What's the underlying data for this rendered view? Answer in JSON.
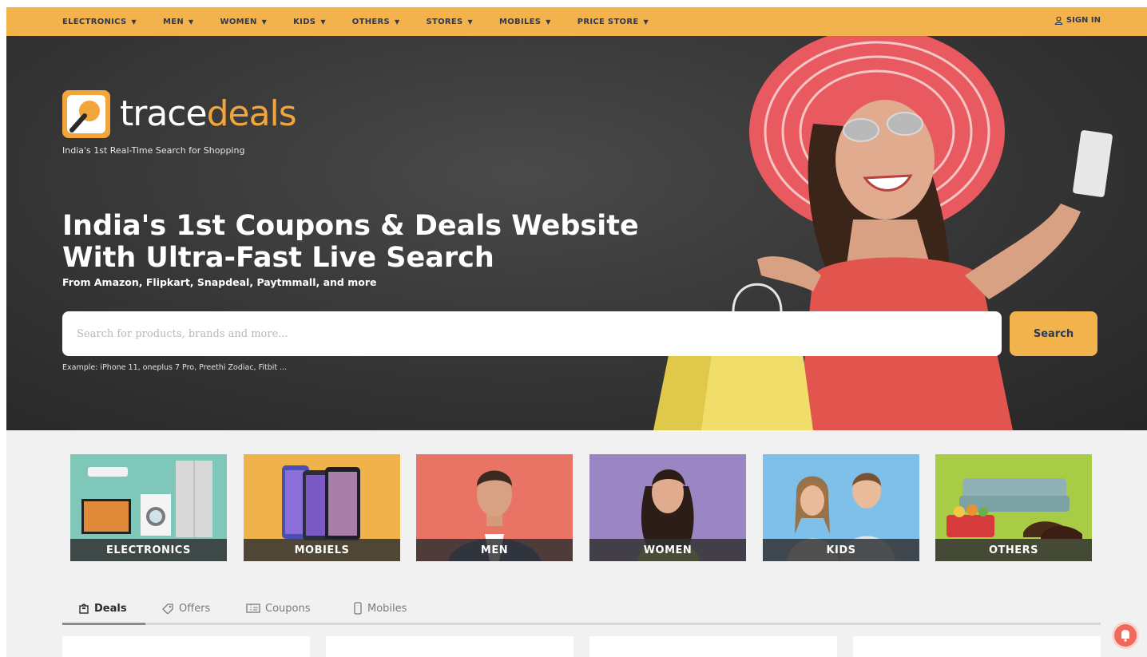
{
  "nav": {
    "items": [
      "ELECTRONICS",
      "MEN",
      "WOMEN",
      "KIDS",
      "OTHERS",
      "STORES",
      "MOBILES",
      "PRICE STORE"
    ],
    "signin": "SIGN IN"
  },
  "hero": {
    "logo_trace": "trace",
    "logo_deals": "deals",
    "tagline": "India's 1st Real-Time Search for Shopping",
    "headline": "India's 1st Coupons & Deals Website With Ultra-Fast Live Search",
    "subhead": "From Amazon, Flipkart, Snapdeal, Paytmmall, and more",
    "search_placeholder": "Search for products, brands and more...",
    "search_button": "Search",
    "example": "Example: iPhone 11, oneplus 7 Pro, Preethi Zodiac, Fitbit ..."
  },
  "categories": [
    {
      "label": "ELECTRONICS",
      "bg": "#7fc7b8"
    },
    {
      "label": "MOBIELS",
      "bg": "#f0b24a"
    },
    {
      "label": "MEN",
      "bg": "#e97466"
    },
    {
      "label": "WOMEN",
      "bg": "#9b86c4"
    },
    {
      "label": "KIDS",
      "bg": "#7ec0e9"
    },
    {
      "label": "OTHERS",
      "bg": "#a9cc47"
    }
  ],
  "tabs": [
    "Deals",
    "Offers",
    "Coupons",
    "Mobiles"
  ],
  "colors": {
    "accent": "#f2b24c",
    "brand_orange": "#f2a53b",
    "hero_bg": "#2e2e2e"
  }
}
